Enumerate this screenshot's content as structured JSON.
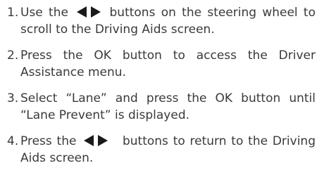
{
  "steps": [
    {
      "number": "1.",
      "before": "Use the",
      "icon": "left-right-arrows-icon",
      "after": "buttons on the steering wheel to scroll to the Driving Aids screen."
    },
    {
      "number": "2.",
      "text": "Press the OK button to access the Driver Assistance menu."
    },
    {
      "number": "3.",
      "text": "Select “Lane” and press the OK button until “Lane Prevent” is displayed."
    },
    {
      "number": "4.",
      "before": "Press the",
      "icon": "left-right-arrows-icon",
      "after": "buttons to return to the Driving Aids screen."
    }
  ],
  "colors": {
    "text": "#3a3a3a",
    "icon": "#1a1a1a"
  }
}
